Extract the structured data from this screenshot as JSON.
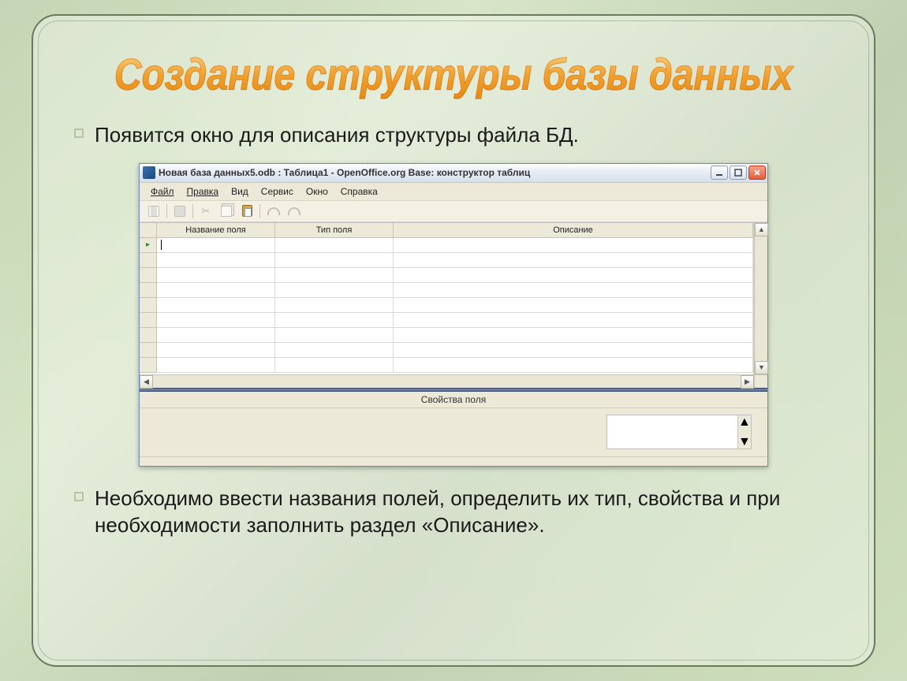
{
  "slide": {
    "headline": "Создание структуры базы данных",
    "intro_text": "Появится окно для описания структуры файла БД.",
    "outro_text": "Необходимо ввести названия полей, определить их тип, свойства и при необходимости заполнить раздел «Описание»."
  },
  "window": {
    "title": "Новая база данных5.odb : Таблица1 - OpenOffice.org Base: конструктор таблиц",
    "menus": {
      "file": "Файл",
      "edit": "Правка",
      "view": "Вид",
      "tools": "Сервис",
      "window": "Окно",
      "help": "Справка"
    },
    "columns": {
      "name": "Название поля",
      "type": "Тип поля",
      "desc": "Описание"
    },
    "properties_header": "Свойства поля",
    "row_count": 9,
    "current_row_marker": "▸"
  }
}
